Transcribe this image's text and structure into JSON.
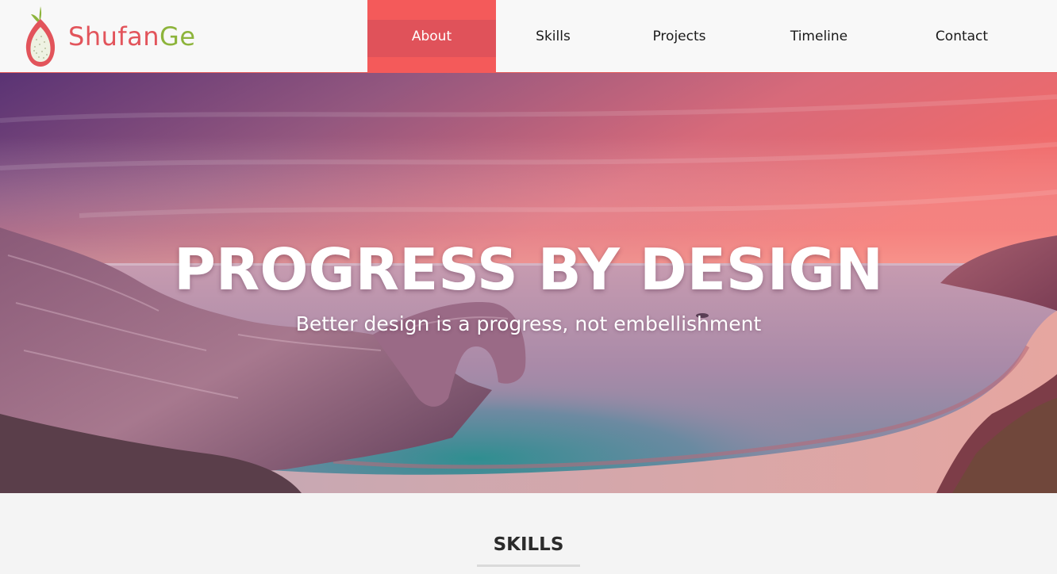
{
  "header": {
    "logo": {
      "text_part1": "Shufan",
      "text_part2": "Ge",
      "icon": "dragonfruit-icon",
      "colors": {
        "red": "#e2545b",
        "green": "#8db43b"
      }
    },
    "nav": [
      {
        "label": "About",
        "active": true
      },
      {
        "label": "Skills",
        "active": false
      },
      {
        "label": "Projects",
        "active": false
      },
      {
        "label": "Timeline",
        "active": false
      },
      {
        "label": "Contact",
        "active": false
      }
    ],
    "accent_color": "#f45a5a"
  },
  "hero": {
    "title": "PROGRESS BY DESIGN",
    "subtitle": "Better design is a progress, not embellishment",
    "image": "coastal-sunset-sea-arch"
  },
  "skills": {
    "heading": "SKILLS"
  }
}
